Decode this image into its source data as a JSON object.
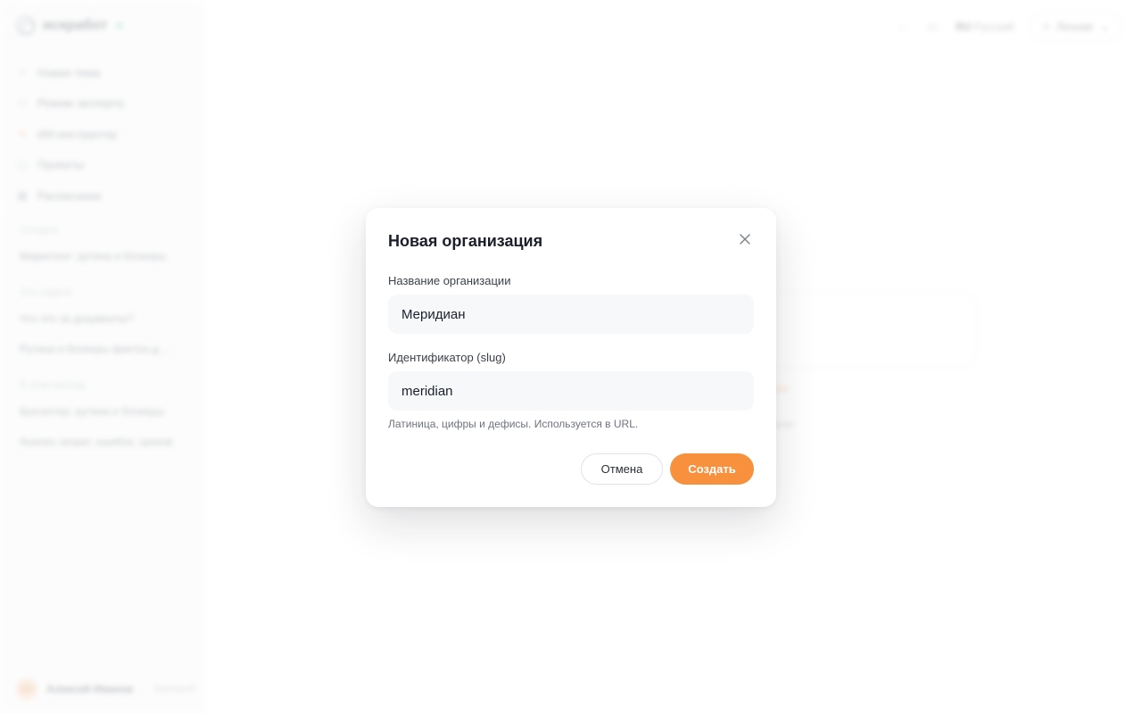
{
  "app": {
    "name": "искработ"
  },
  "sidebar": {
    "nav": [
      {
        "label": "Новая тема",
        "icon": "plus-icon"
      },
      {
        "label": "Режим эксперта",
        "icon": "users-icon"
      },
      {
        "label": "ИИ-инструктор",
        "icon": "sparkle-icon"
      },
      {
        "label": "Проекты",
        "icon": "folder-icon"
      },
      {
        "label": "Расписание",
        "icon": "calendar-icon"
      }
    ],
    "sections": [
      {
        "title": "Сегодня",
        "items": [
          "Маркетинг: рутина и блокеры"
        ]
      },
      {
        "title": "Эта неделя",
        "items": [
          "Что это за документы?",
          "Рутина и блокеры финтех-д…"
        ]
      },
      {
        "title": "В этом месяце",
        "items": [
          "Бухгалтер: рутина и блокеры",
          "Анализ затрат, ошибок, сроков"
        ]
      }
    ],
    "user": {
      "initials": "АИ",
      "name": "Алексей Иванов",
      "plan": "Базовый"
    }
  },
  "topbar": {
    "lang": "RU",
    "lang_alt": "Русский",
    "workspace": "Личная"
  },
  "main": {
    "greeting": "ксей",
    "link": "рую",
    "note": "вания"
  },
  "modal": {
    "title": "Новая организация",
    "name_label": "Название организации",
    "name_value": "Меридиан",
    "slug_label": "Идентификатор (slug)",
    "slug_value": "meridian",
    "hint": "Латиница, цифры и дефисы. Используется в URL.",
    "cancel": "Отмена",
    "create": "Создать"
  },
  "colors": {
    "accent": "#f7913d",
    "input_bg": "#f6f8f9",
    "online": "#3cc58a"
  }
}
